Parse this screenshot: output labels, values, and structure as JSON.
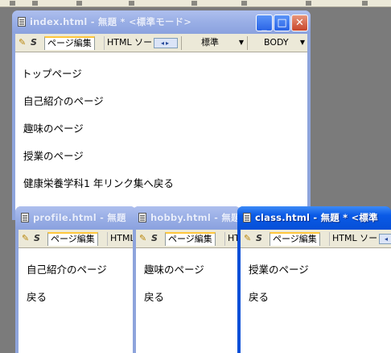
{
  "main_window": {
    "title": "index.html - 無題 * <標準モード>",
    "tab_page_edit": "ページ編集",
    "tab_html_source": "HTML ソー",
    "format_select": "標準",
    "tag_select": "BODY",
    "content": [
      "トップページ",
      "自己紹介のページ",
      "趣味のページ",
      "授業のページ",
      "健康栄養学科1 年リンク集へ戻る"
    ]
  },
  "profile_window": {
    "title": "profile.html - 無題",
    "tab_page_edit": "ページ編集",
    "tab_html_source": "HTML",
    "content": [
      "自己紹介のページ",
      "戻る"
    ]
  },
  "hobby_window": {
    "title": "hobby.html - 無題",
    "tab_page_edit": "ページ編集",
    "tab_html_source": "HT",
    "content": [
      "趣味のページ",
      "戻る"
    ]
  },
  "class_window": {
    "title": "class.html - 無題 * <標準",
    "tab_page_edit": "ページ編集",
    "tab_html_source": "HTML ソー",
    "content": [
      "授業のページ",
      "戻る"
    ]
  }
}
